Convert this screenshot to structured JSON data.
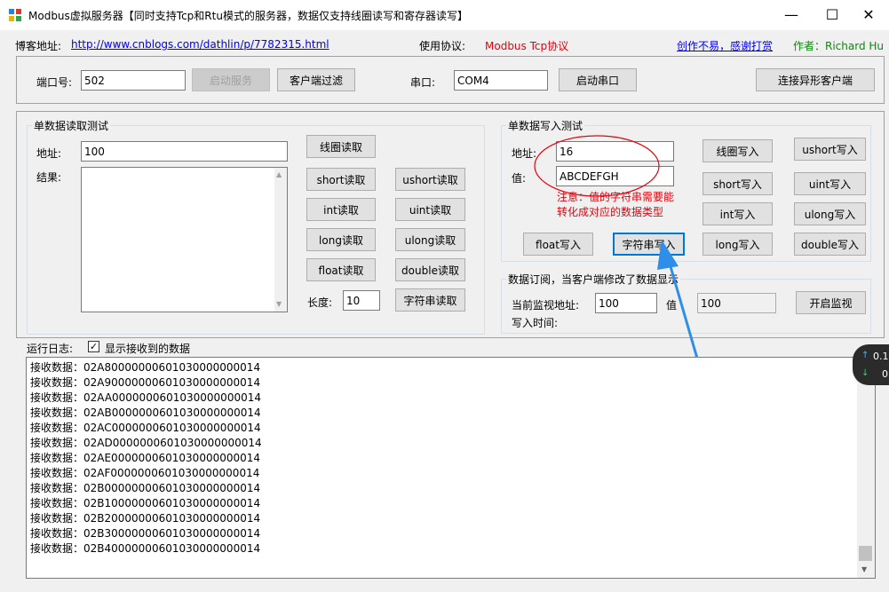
{
  "window": {
    "title": "Modbus虚拟服务器【同时支持Tcp和Rtu模式的服务器，数据仅支持线圈读写和寄存器读写】",
    "minimize": "—",
    "maximize": "☐",
    "close": "✕"
  },
  "info": {
    "blog_label": "博客地址:",
    "blog_url": "http://www.cnblogs.com/dathlin/p/7782315.html",
    "protocol_label": "使用协议:",
    "protocol_value": "Modbus Tcp协议",
    "donate_link": "创作不易，感谢打赏",
    "author": "作者：Richard Hu"
  },
  "server": {
    "port_label": "端口号:",
    "port_value": "502",
    "start_button": "启动服务",
    "filter_button": "客户端过滤",
    "serial_label": "串口:",
    "serial_value": "COM4",
    "start_serial_button": "启动串口",
    "connect_button": "连接异形客户端"
  },
  "read_group": {
    "title": "单数据读取测试",
    "addr_label": "地址:",
    "addr_value": "100",
    "result_label": "结果:",
    "coil_read": "线圈读取",
    "short_read": "short读取",
    "ushort_read": "ushort读取",
    "int_read": "int读取",
    "uint_read": "uint读取",
    "long_read": "long读取",
    "ulong_read": "ulong读取",
    "float_read": "float读取",
    "double_read": "double读取",
    "length_label": "长度:",
    "length_value": "10",
    "string_read": "字符串读取"
  },
  "write_group": {
    "title": "单数据写入测试",
    "addr_label": "地址:",
    "addr_value": "16",
    "value_label": "值:",
    "value_value": "ABCDEFGH",
    "note": "注意：值的字符串需要能转化成对应的数据类型",
    "coil_write": "线圈写入",
    "ushort_write": "ushort写入",
    "short_write": "short写入",
    "uint_write": "uint写入",
    "int_write": "int写入",
    "ulong_write": "ulong写入",
    "float_write": "float写入",
    "string_write": "字符串写入",
    "long_write": "long写入",
    "double_write": "double写入"
  },
  "subscribe_group": {
    "title": "数据订阅，当客户端修改了数据显示",
    "monitor_addr_label": "当前监视地址:",
    "monitor_addr_value": "100",
    "value_label": "值",
    "value_value": "100",
    "start_monitor": "开启监视",
    "write_time_label": "写入时间:"
  },
  "log": {
    "label": "运行日志:",
    "show_received_label": "显示接收到的数据",
    "show_received_checked": true,
    "lines": [
      "接收数据：02A80000000601030000000014",
      "接收数据：02A90000000601030000000014",
      "接收数据：02AA0000000601030000000014",
      "接收数据：02AB0000000601030000000014",
      "接收数据：02AC0000000601030000000014",
      "接收数据：02AD0000000601030000000014",
      "接收数据：02AE0000000601030000000014",
      "接收数据：02AF0000000601030000000014",
      "接收数据：02B00000000601030000000014",
      "接收数据：02B10000000601030000000014",
      "接收数据：02B20000000601030000000014",
      "接收数据：02B30000000601030000000014",
      "接收数据：02B40000000601030000000014"
    ]
  },
  "net_widget": {
    "up": "0.1",
    "down": "0"
  },
  "colors": {
    "annotation_red": "#e8000b",
    "arrow_blue": "#2f8fe8",
    "focus_blue": "#0078d7"
  }
}
